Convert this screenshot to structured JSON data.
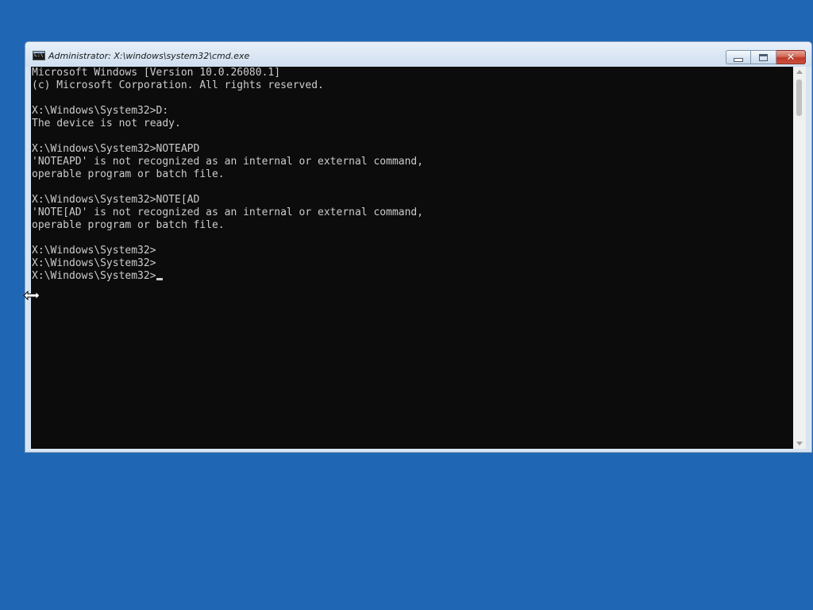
{
  "desktop": {
    "background_color": "#1f67b4"
  },
  "window": {
    "title": "Administrator: X:\\windows\\system32\\cmd.exe",
    "icon": "cmd-icon",
    "icon_text": "C:\\",
    "controls": {
      "minimize": "minimize-icon",
      "maximize": "restore-icon",
      "close": "close-icon",
      "close_glyph": "✕"
    }
  },
  "console": {
    "background_color": "#0c0c0c",
    "text_color": "#cccccc",
    "lines": [
      "Microsoft Windows [Version 10.0.26080.1]",
      "(c) Microsoft Corporation. All rights reserved.",
      "",
      "X:\\Windows\\System32>D:",
      "The device is not ready.",
      "",
      "X:\\Windows\\System32>NOTEAPD",
      "'NOTEAPD' is not recognized as an internal or external command,",
      "operable program or batch file.",
      "",
      "X:\\Windows\\System32>NOTE[AD",
      "'NOTE[AD' is not recognized as an internal or external command,",
      "operable program or batch file.",
      "",
      "X:\\Windows\\System32>",
      "X:\\Windows\\System32>",
      "X:\\Windows\\System32>"
    ]
  },
  "mouse_cursor": "horizontal-resize-cursor"
}
